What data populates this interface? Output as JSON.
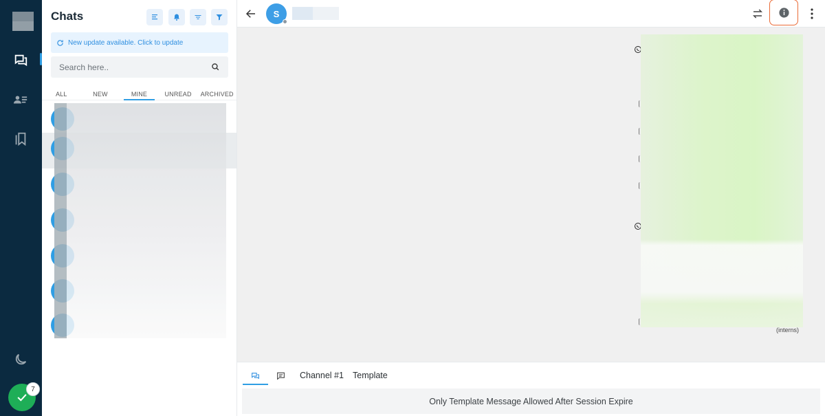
{
  "sidebar": {
    "nav": [
      {
        "icon": "chat-bubbles-icon",
        "active": true
      },
      {
        "icon": "contacts-icon",
        "active": false
      },
      {
        "icon": "bookmarks-icon",
        "active": false
      }
    ],
    "theme_icon": "moon-icon",
    "badge_count": "7",
    "accent": "#2f9ee4",
    "bg": "#0b2a40"
  },
  "chats": {
    "title": "Chats",
    "update_banner": "New update available. Click to update",
    "search_placeholder": "Search here..",
    "tabs": [
      "ALL",
      "NEW",
      "MINE",
      "UNREAD",
      "ARCHIVED"
    ],
    "active_tab": "MINE"
  },
  "conversation": {
    "avatar_initial": "S",
    "message_time": "(interns)",
    "composer": {
      "channel_label": "Channel #1",
      "template_label": "Template",
      "notice": "Only Template Message Allowed After Session Expire"
    }
  }
}
